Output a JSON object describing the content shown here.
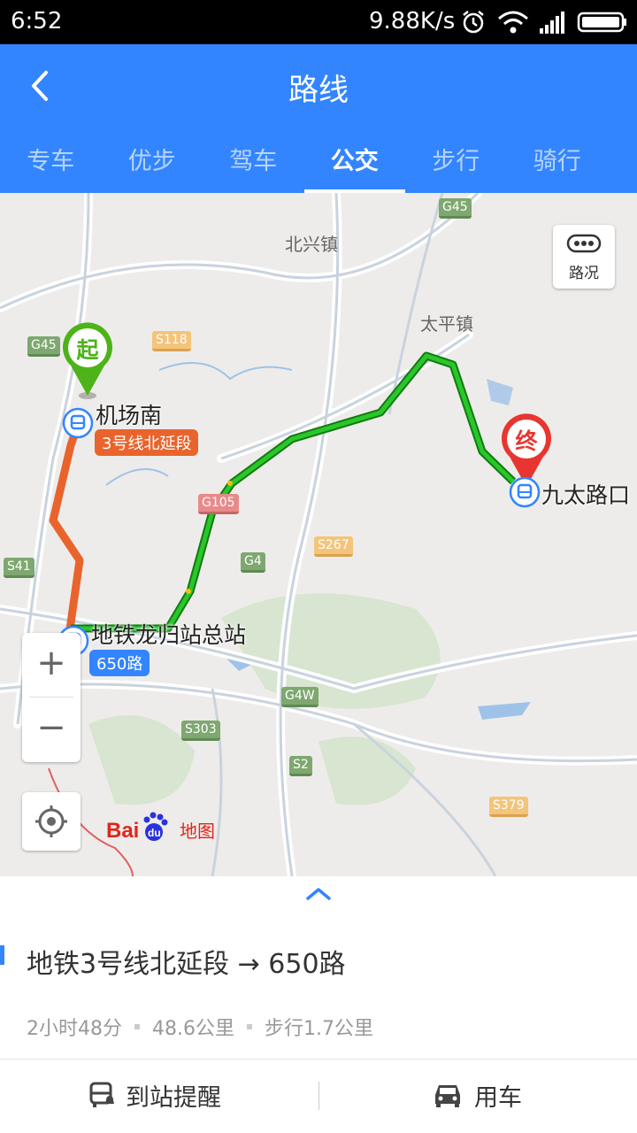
{
  "status_bar": {
    "time": "6:52",
    "network_speed": "9.88K/s"
  },
  "header": {
    "title": "路线",
    "tabs": [
      {
        "label": "专车"
      },
      {
        "label": "优步"
      },
      {
        "label": "驾车"
      },
      {
        "label": "公交",
        "active": true
      },
      {
        "label": "步行"
      },
      {
        "label": "骑行"
      }
    ]
  },
  "map": {
    "place_labels": [
      "北兴镇",
      "太平镇"
    ],
    "road_badges": [
      "G45",
      "G45",
      "S118",
      "G105",
      "S267",
      "S41",
      "G4",
      "G4W",
      "S303",
      "S2",
      "S379"
    ],
    "start_marker": "起",
    "end_marker": "终",
    "start_station": "机场南",
    "start_line": "3号线北延段",
    "transfer_station": "地铁龙归站总站",
    "transfer_line": "650路",
    "end_station": "九太路口",
    "traffic_label": "路况",
    "zoom_in": "+",
    "zoom_out": "−",
    "logo_text": "Baidu地图",
    "colors": {
      "metro_line": "#e8642c",
      "bus_line": "#1eb01e",
      "bus_tag": "#3385ff"
    }
  },
  "route": {
    "title": "地铁3号线北延段 → 650路",
    "duration": "2小时48分",
    "distance": "48.6公里",
    "walking": "步行1.7公里"
  },
  "actions": {
    "arrival_alert": "到站提醒",
    "ride": "用车"
  }
}
